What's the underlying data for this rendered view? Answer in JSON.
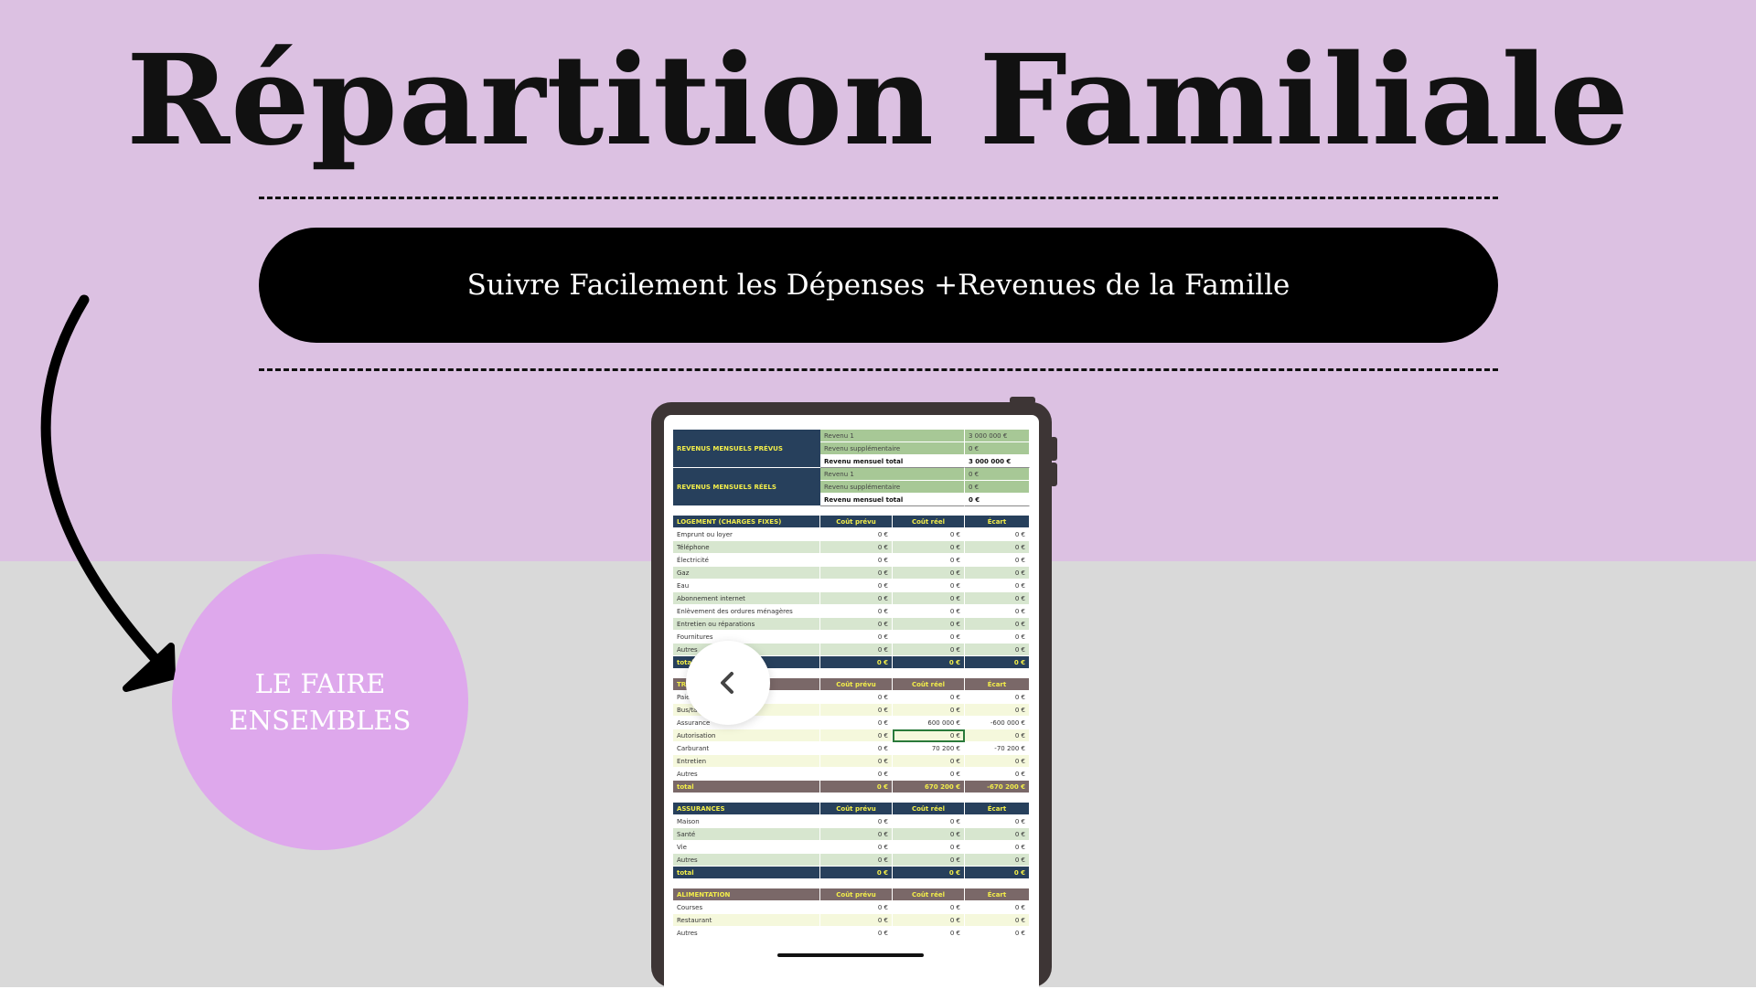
{
  "header": {
    "title": "Répartition Familiale",
    "subtitle": "Suivre Facilement les Dépenses +Revenues de la Famille"
  },
  "badge": {
    "text": "LE FAIRE ENSEMBLES"
  },
  "colors": {
    "top_bg": "#dcc1e2",
    "bottom_bg": "#d9d9d9",
    "circle": "#dea8ec",
    "pill": "#000000",
    "sheet_navy": "#27405c",
    "sheet_brown": "#7a6868",
    "sheet_accent": "#f3ee4a"
  },
  "icons": {
    "back": "chevron-left-icon",
    "arrow": "curved-arrow-icon"
  },
  "sheet": {
    "revenus_prevus": {
      "label": "REVENUS MENSUELS PRÉVUS",
      "rows": [
        {
          "name": "Revenu 1",
          "value": "3 000 000 €"
        },
        {
          "name": "Revenu supplémentaire",
          "value": "0 €"
        },
        {
          "name": "Revenu mensuel total",
          "value": "3 000 000 €"
        }
      ]
    },
    "revenus_reels": {
      "label": "REVENUS MENSUELS RÉELS",
      "rows": [
        {
          "name": "Revenu 1",
          "value": "0 €"
        },
        {
          "name": "Revenu supplémentaire",
          "value": "0 €"
        },
        {
          "name": "Revenu mensuel total",
          "value": "0 €"
        }
      ]
    },
    "columns": [
      "Coût prévu",
      "Coût réel",
      "Écart"
    ],
    "logement": {
      "title": "LOGEMENT (CHARGES FIXES)",
      "rows": [
        [
          "Emprunt ou loyer",
          "0 €",
          "0 €",
          "0 €"
        ],
        [
          "Téléphone",
          "0 €",
          "0 €",
          "0 €"
        ],
        [
          "Électricité",
          "0 €",
          "0 €",
          "0 €"
        ],
        [
          "Gaz",
          "0 €",
          "0 €",
          "0 €"
        ],
        [
          "Eau",
          "0 €",
          "0 €",
          "0 €"
        ],
        [
          "Abonnement internet",
          "0 €",
          "0 €",
          "0 €"
        ],
        [
          "Enlèvement des ordures ménagères",
          "0 €",
          "0 €",
          "0 €"
        ],
        [
          "Entretien ou réparations",
          "0 €",
          "0 €",
          "0 €"
        ],
        [
          "Fournitures",
          "0 €",
          "0 €",
          "0 €"
        ],
        [
          "Autres",
          "0 €",
          "0 €",
          "0 €"
        ]
      ],
      "total": [
        "total",
        "0 €",
        "0 €",
        "0 €"
      ]
    },
    "transport": {
      "title": "TRANSPORT",
      "rows": [
        [
          "Paiement",
          "0 €",
          "0 €",
          "0 €"
        ],
        [
          "Bus/taxi",
          "0 €",
          "0 €",
          "0 €"
        ],
        [
          "Assurance",
          "0 €",
          "600 000 €",
          "-600 000 €"
        ],
        [
          "Autorisation",
          "0 €",
          "0 €",
          "0 €"
        ],
        [
          "Carburant",
          "0 €",
          "70 200 €",
          "-70 200 €"
        ],
        [
          "Entretien",
          "0 €",
          "0 €",
          "0 €"
        ],
        [
          "Autres",
          "0 €",
          "0 €",
          "0 €"
        ]
      ],
      "total": [
        "total",
        "0 €",
        "670 200 €",
        "-670 200 €"
      ]
    },
    "assurances": {
      "title": "ASSURANCES",
      "rows": [
        [
          "Maison",
          "0 €",
          "0 €",
          "0 €"
        ],
        [
          "Santé",
          "0 €",
          "0 €",
          "0 €"
        ],
        [
          "Vie",
          "0 €",
          "0 €",
          "0 €"
        ],
        [
          "Autres",
          "0 €",
          "0 €",
          "0 €"
        ]
      ],
      "total": [
        "total",
        "0 €",
        "0 €",
        "0 €"
      ]
    },
    "alimentation": {
      "title": "ALIMENTATION",
      "rows": [
        [
          "Courses",
          "0 €",
          "0 €",
          "0 €"
        ],
        [
          "Restaurant",
          "0 €",
          "0 €",
          "0 €"
        ],
        [
          "Autres",
          "0 €",
          "0 €",
          "0 €"
        ]
      ]
    }
  }
}
